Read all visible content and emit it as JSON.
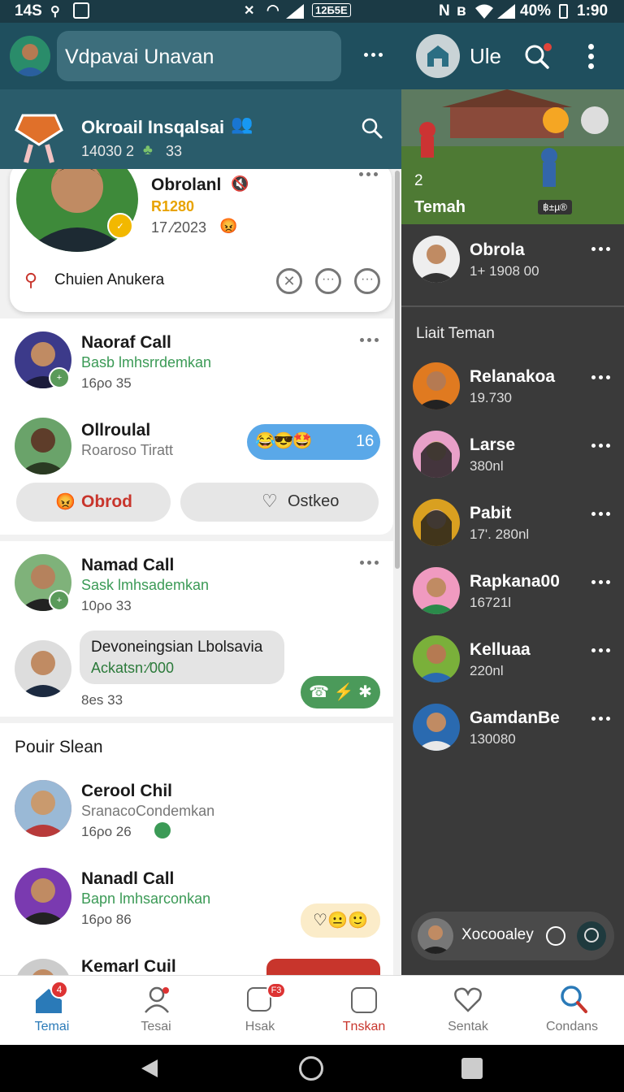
{
  "status": {
    "time_left": "14S",
    "battery": "40%",
    "clock": "1:90",
    "net_box": "12Б5Е"
  },
  "topbar": {
    "title": "Vdpavai Unavan",
    "right_title": "Ule"
  },
  "group": {
    "title": "Okroail Insqalsai",
    "stats": "14030 2",
    "count": "33"
  },
  "featured": {
    "name": "Obrolanl",
    "points": "R1280",
    "date": "17.⁄2023",
    "action": "Chuien Anukera"
  },
  "chats": [
    {
      "name": "Naoraf Call",
      "sub": "Basb lmhsrrdemkan",
      "meta": "16ρο 35"
    },
    {
      "name": "Ollroulal",
      "sub": "Roaroso Tiratt",
      "reactions": "16"
    },
    {
      "name": "Namad Call",
      "sub": "Sask lmhsademkan",
      "meta": "10ρο 33"
    },
    {
      "name": "",
      "bubble_title": "Devoneingsian Lbolsavia",
      "bubble_sub": "Ackatsn:⁄000",
      "meta": "8es 33"
    }
  ],
  "buttons": {
    "left": "Obrod",
    "right": "Ostkeo"
  },
  "section_title": "Pouir Slean",
  "chats2": [
    {
      "name": "Cerool Chil",
      "sub": "SranacoCondemkan",
      "meta": "16ρο 26"
    },
    {
      "name": "Nanadl Call",
      "sub": "Bapn lmhsarconkan",
      "meta": "16ρο 86"
    },
    {
      "name": "Kemarl Cuil"
    }
  ],
  "right": {
    "game_count": "2",
    "game_label": "Temah",
    "game_tag": "฿±µ®",
    "pinned": {
      "name": "Obrola",
      "sub": "1+ 1908 00"
    },
    "list_title": "Liait Teman",
    "friends": [
      {
        "name": "Relanakoa",
        "sub": "19.730"
      },
      {
        "name": "Larse",
        "sub": "380nl"
      },
      {
        "name": "Pabit",
        "sub": "17'. 280nl"
      },
      {
        "name": "Rapkana00",
        "sub": "16721l"
      },
      {
        "name": "Kelluaa",
        "sub": "220nl"
      },
      {
        "name": "GamdanBe",
        "sub": "130080"
      }
    ],
    "bottom_chip": "Xocooaley"
  },
  "nav": [
    {
      "label": "Temai",
      "badge": "4"
    },
    {
      "label": "Tesai"
    },
    {
      "label": "Hsak",
      "badge": "F3"
    },
    {
      "label": "Tnskan"
    },
    {
      "label": "Sentak"
    },
    {
      "label": "Condans"
    }
  ],
  "colors": {
    "teal": "#1f4f5e",
    "green": "#3b9a56",
    "orange": "#e0702a",
    "red": "#c8352c",
    "blue": "#1a6fa8"
  }
}
